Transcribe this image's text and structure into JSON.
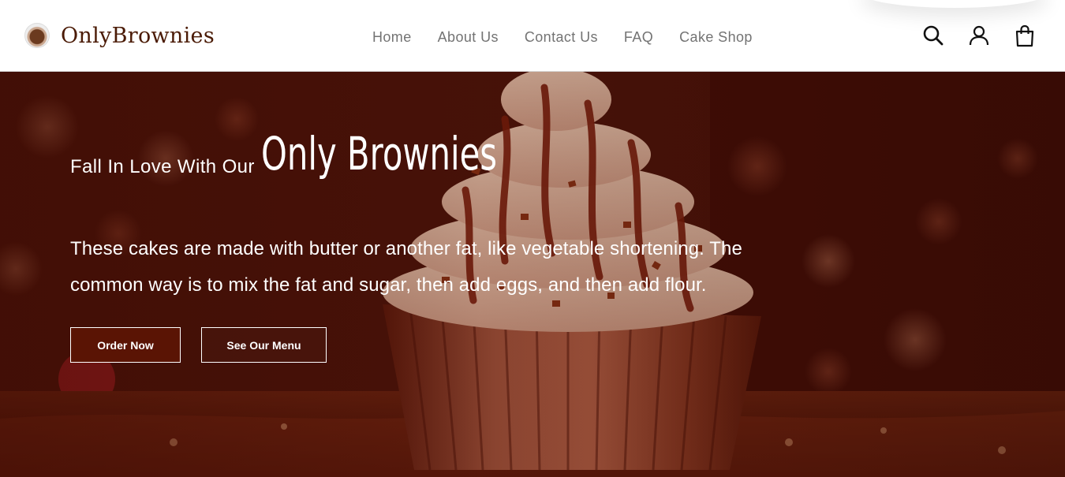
{
  "brand": {
    "name": "OnlyBrownies",
    "logo_icon": "brownie-logo-icon"
  },
  "nav": {
    "items": [
      {
        "label": "Home"
      },
      {
        "label": "About Us"
      },
      {
        "label": "Contact Us"
      },
      {
        "label": "FAQ"
      },
      {
        "label": "Cake Shop"
      }
    ]
  },
  "header_icons": [
    "search-icon",
    "user-icon",
    "shopping-bag-icon"
  ],
  "hero": {
    "pre_title": "Fall In Love With Our",
    "title": "Only Brownies",
    "description": "These cakes are made with butter or another fat, like vegetable shortening. The common way is to mix the fat and sugar, then add eggs, and then add flour.",
    "primary_button": "Order Now",
    "secondary_button": "See Our Menu",
    "background_image": "cupcake-with-chocolate-drizzle"
  },
  "colors": {
    "brand_text": "#4a1a05",
    "nav_text": "#737373",
    "hero_tint": "#3f0f06",
    "primary_button_bg": "#5a1404"
  }
}
